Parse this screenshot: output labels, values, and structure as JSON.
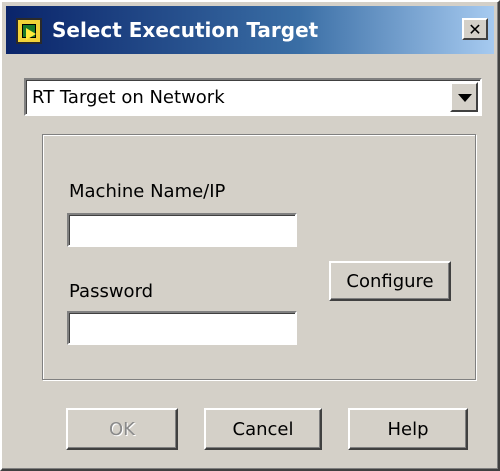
{
  "window": {
    "title": "Select Execution Target",
    "close_symbol": "✕"
  },
  "target_dropdown": {
    "selected": "RT Target on Network"
  },
  "group": {
    "machine_label": "Machine Name/IP",
    "machine_value": "",
    "password_label": "Password",
    "password_value": "",
    "configure_label": "Configure"
  },
  "buttons": {
    "ok": "OK",
    "cancel": "Cancel",
    "help": "Help"
  },
  "icons": {
    "app": "labview-target-icon",
    "close": "close-icon",
    "dropdown": "chevron-down-icon"
  }
}
